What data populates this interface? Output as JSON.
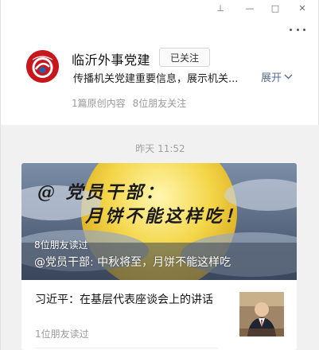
{
  "window": {
    "pin_glyph": "⊥",
    "minimize_glyph": "—",
    "maximize_glyph": "□",
    "close_glyph": "✕"
  },
  "profile": {
    "name": "临沂外事党建",
    "follow_label": "已关注",
    "description": "传播机关党建重要信息，展示机关...",
    "expand_label": "展开",
    "stats": {
      "original_count": "1篇原创内容",
      "friends_following": "8位朋友关注"
    }
  },
  "feed": {
    "time_label": "昨天 11:52",
    "featured": {
      "cover_line1": "@ 党员干部：",
      "cover_line2": "月饼不能这样吃！",
      "readers": "8位朋友读过",
      "title": "@党员干部: 中秋将至，月饼不能这样吃"
    },
    "articles": [
      {
        "title": "习近平：在基层代表座谈会上的讲话",
        "readers": "1位朋友读过"
      }
    ]
  },
  "colors": {
    "link": "#576b95",
    "logo_red": "#c8161d",
    "feed_bg": "#f1f1f1"
  },
  "icons": [
    "pin-icon",
    "minimize-icon",
    "maximize-icon",
    "close-icon",
    "more-icon",
    "chevron-down-icon",
    "logo-icon"
  ]
}
